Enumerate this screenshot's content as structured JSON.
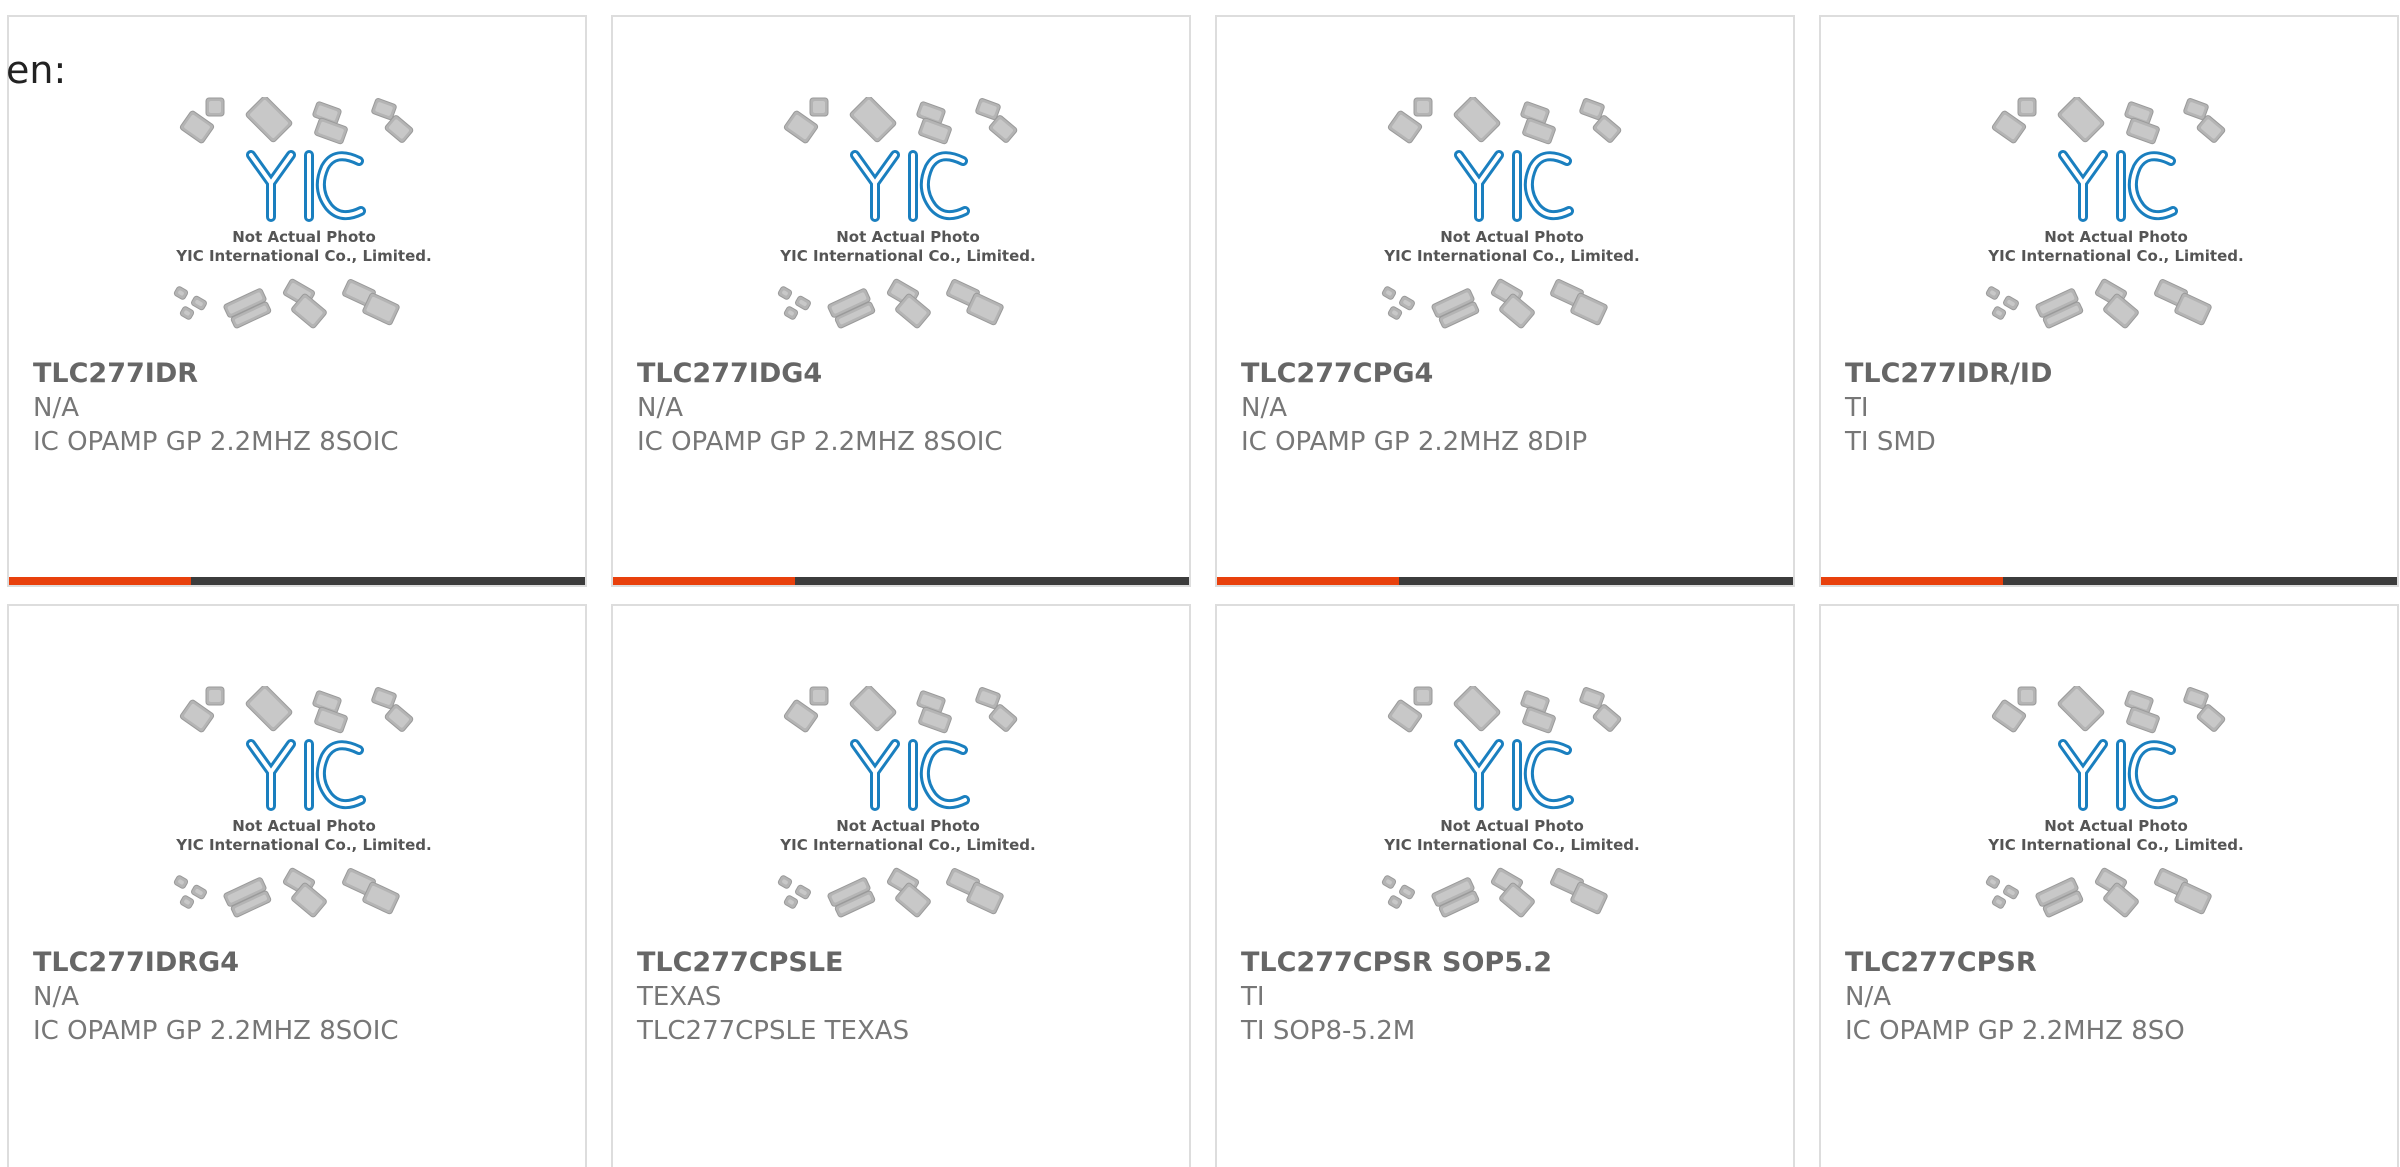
{
  "language_label": "en:",
  "placeholder_image": {
    "line1": "Not Actual Photo",
    "line2": "YIC International Co., Limited.",
    "logo_text": "YIC"
  },
  "colors": {
    "accent": "#e8400c",
    "bar": "#3c3c3c",
    "logo": "#1a7fbf"
  },
  "products": [
    {
      "part_number": "TLC277IDR",
      "manufacturer": "N/A",
      "description": "IC OPAMP GP 2.2MHZ 8SOIC"
    },
    {
      "part_number": "TLC277IDG4",
      "manufacturer": "N/A",
      "description": "IC OPAMP GP 2.2MHZ 8SOIC"
    },
    {
      "part_number": "TLC277CPG4",
      "manufacturer": "N/A",
      "description": "IC OPAMP GP 2.2MHZ 8DIP"
    },
    {
      "part_number": "TLC277IDR/ID",
      "manufacturer": "TI",
      "description": "TI SMD"
    },
    {
      "part_number": "TLC277IDRG4",
      "manufacturer": "N/A",
      "description": "IC OPAMP GP 2.2MHZ 8SOIC"
    },
    {
      "part_number": "TLC277CPSLE",
      "manufacturer": "TEXAS",
      "description": "TLC277CPSLE TEXAS"
    },
    {
      "part_number": "TLC277CPSR SOP5.2",
      "manufacturer": "TI",
      "description": "TI SOP8-5.2M"
    },
    {
      "part_number": "TLC277CPSR",
      "manufacturer": "N/A",
      "description": "IC OPAMP GP 2.2MHZ 8SO"
    }
  ]
}
